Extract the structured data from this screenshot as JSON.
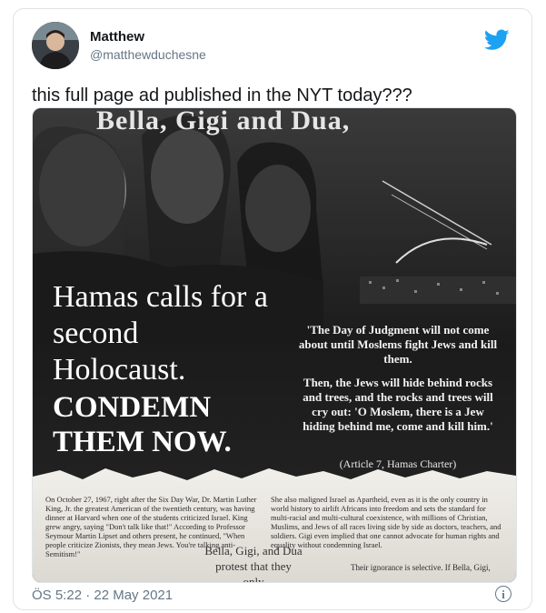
{
  "tweet": {
    "author_name": "Matthew",
    "author_handle": "@matthewduchesne",
    "text": "this full page ad published in the NYT today???",
    "timestamp": "ÖS 5:22 · 22 May 2021"
  },
  "ad": {
    "headline_top": "Bella, Gigi and Dua,",
    "hamas_text": "Hamas calls for a second Holocaust.",
    "condemn_text": "CONDEMN THEM NOW.",
    "quote_part1": "'The Day of Judgment will not come about until Moslems fight Jews and kill them.",
    "quote_part2": "Then, the Jews will hide behind rocks and trees, and the rocks and trees will cry out: 'O Moslem, there is a Jew hiding behind me, come and kill him.'",
    "quote_source": "(Article 7, Hamas Charter)",
    "col1": "On October 27, 1967, right after the Six Day War, Dr. Martin Luther King, Jr. the greatest American of the twentieth century, was having dinner at Harvard when one of the students criticized Israel. King grew angry, saying \"Don't talk like that!\" According to Professor Seymour Martin Lipset and others present, he continued, \"When people criticize Zionists, they mean Jews. You're talking anti-Semitism!\"",
    "col2": "She also maligned Israel as Apartheid, even as it is the only country in world history to airlift Africans into freedom and sets the standard for multi-racial and multi-cultural coexistence, with millions of Christian, Muslims, and Jews of all races living side by side as doctors, teachers, and soldiers. Gigi even implied that one cannot advocate for human rights and equality without condemning Israel.",
    "pull_quote": "Bella, Gigi, and Dua protest that they only",
    "col3_last": "Their ignorance is selective. If Bella, Gigi,"
  },
  "colors": {
    "twitter_blue": "#1da1f2",
    "text_primary": "#14171a",
    "text_secondary": "#657786",
    "border": "#dfe3e6"
  },
  "icons": {
    "brand": "twitter-bird-icon",
    "info": "info-icon"
  }
}
